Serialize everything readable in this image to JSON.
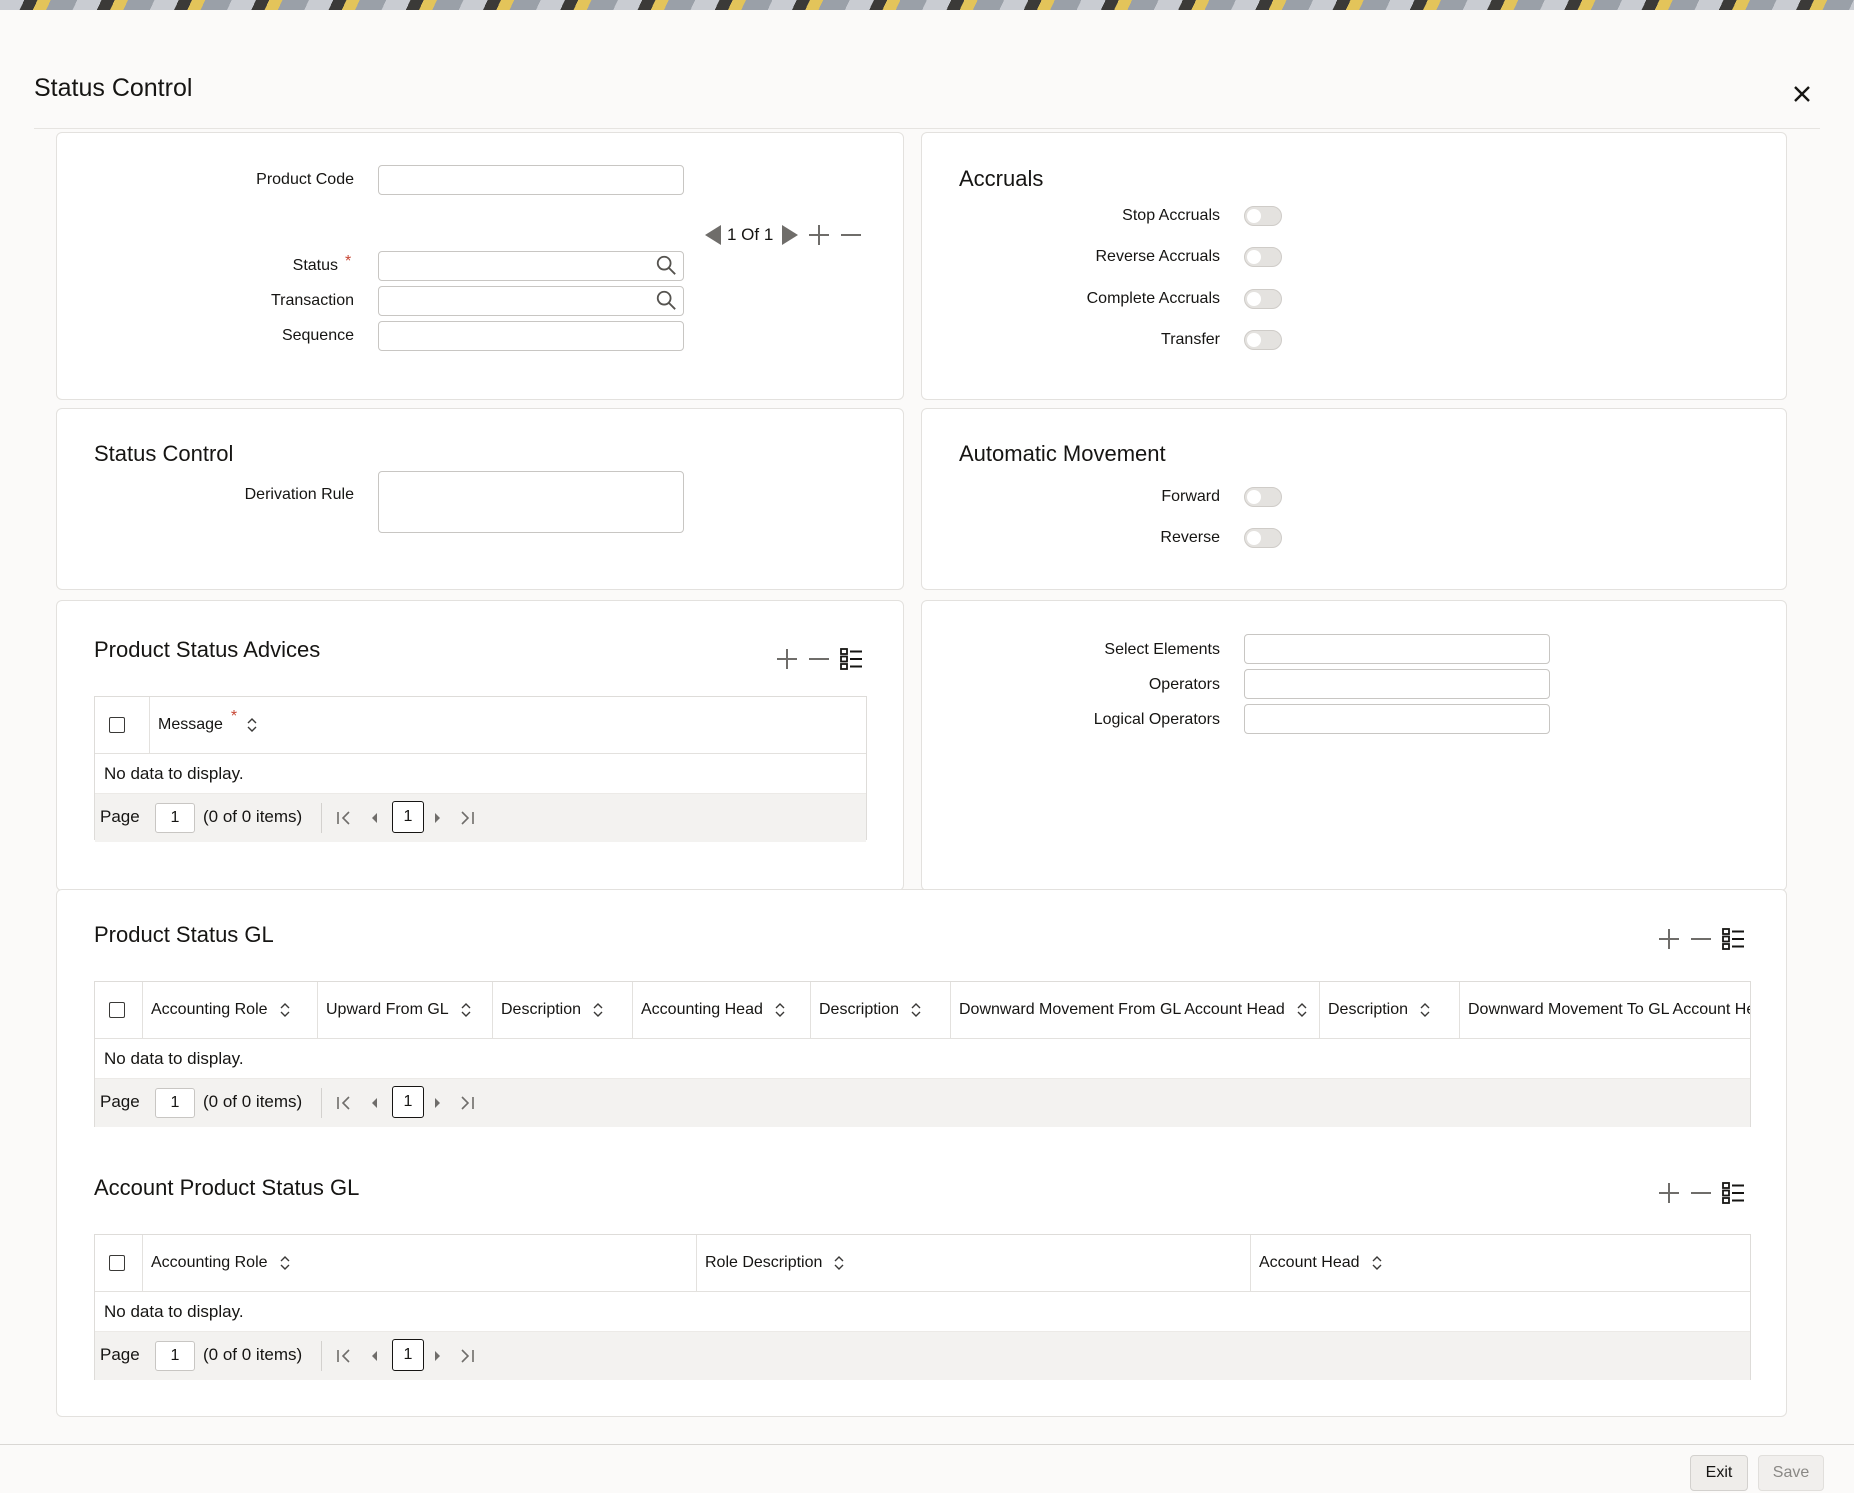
{
  "window": {
    "title": "Status Control"
  },
  "main": {
    "product_code_label": "Product Code",
    "status_label": "Status",
    "required_mark": "*",
    "transaction_label": "Transaction",
    "sequence_label": "Sequence",
    "record_nav": "1 Of 1"
  },
  "accruals": {
    "title": "Accruals",
    "stop_label": "Stop Accruals",
    "reverse_label": "Reverse Accruals",
    "complete_label": "Complete Accruals",
    "transfer_label": "Transfer"
  },
  "status_control": {
    "title": "Status Control",
    "derivation_label": "Derivation Rule"
  },
  "auto_movement": {
    "title": "Automatic Movement",
    "forward_label": "Forward",
    "reverse_label": "Reverse"
  },
  "advices": {
    "title": "Product Status Advices",
    "col_message": "Message",
    "no_data": "No data to display.",
    "page_label": "Page",
    "page_value": "1",
    "items": "(0 of 0 items)",
    "current_page": "1"
  },
  "elements": {
    "select_label": "Select Elements",
    "operators_label": "Operators",
    "logical_label": "Logical Operators"
  },
  "status_gl": {
    "title": "Product Status GL",
    "columns": [
      "Accounting Role",
      "Upward From GL",
      "Description",
      "Accounting Head",
      "Description",
      "Downward Movement From GL Account Head",
      "Description",
      "Downward Movement To GL Account Head"
    ],
    "no_data": "No data to display.",
    "page_label": "Page",
    "page_value": "1",
    "items": "(0 of 0 items)",
    "current_page": "1"
  },
  "acct_status_gl": {
    "title": "Account Product Status GL",
    "columns": [
      "Accounting Role",
      "Role Description",
      "Account Head"
    ],
    "no_data": "No data to display.",
    "page_label": "Page",
    "page_value": "1",
    "items": "(0 of 0 items)",
    "current_page": "1"
  },
  "footer": {
    "exit_label": "Exit",
    "save_label": "Save"
  },
  "colors": {
    "required": "#c74634",
    "text": "#161513",
    "disabled_text": "#8a8885"
  }
}
